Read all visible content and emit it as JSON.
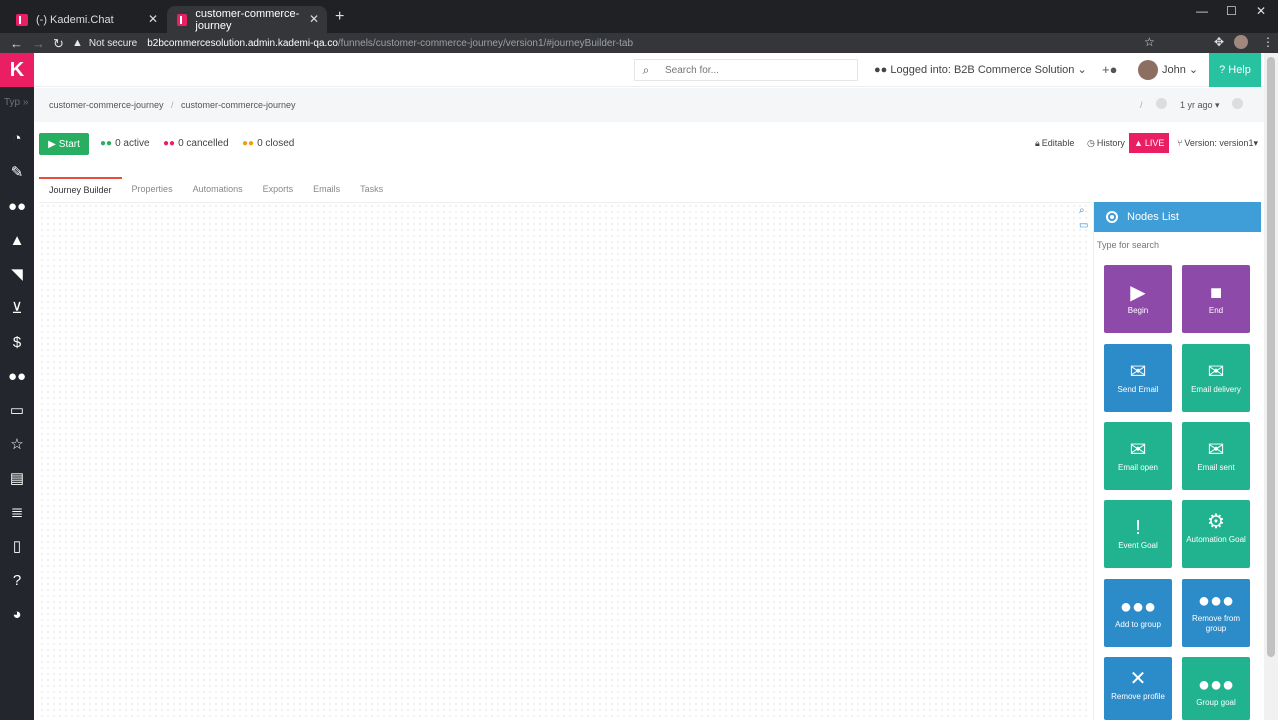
{
  "browser": {
    "tabs": [
      {
        "title": "(-) Kademi.Chat",
        "active": false
      },
      {
        "title": "customer-commerce-journey",
        "active": true
      }
    ],
    "security": "Not secure",
    "url_host": "b2bcommercesolution.admin.kademi-qa.co",
    "url_path": "/funnels/customer-commerce-journey/version1/#journeyBuilder-tab"
  },
  "sidebar": {
    "search": "Typ",
    "icons": [
      "dashboard-icon",
      "edit-icon",
      "users-icon",
      "graduation-icon",
      "rss-icon",
      "cart-icon",
      "dollar-icon",
      "group-icon",
      "monitor-icon",
      "star-icon",
      "id-card-icon",
      "database-icon",
      "file-icon",
      "question-icon",
      "pie-chart-icon"
    ]
  },
  "topbar": {
    "search_placeholder": "Search for...",
    "logged_into": "Logged into: B2B Commerce Solution",
    "user": "John",
    "help": "Help"
  },
  "breadcrumb": {
    "items": [
      "customer-commerce-journey",
      "customer-commerce-journey"
    ],
    "age": "1 yr ago"
  },
  "stats": {
    "start_label": "Start",
    "active": "0 active",
    "cancelled": "0 cancelled",
    "closed": "0 closed"
  },
  "actions": {
    "editable": "Editable",
    "history": "History",
    "live": "LIVE",
    "version": "Version: version1"
  },
  "tabs": [
    "Journey Builder",
    "Properties",
    "Automations",
    "Exports",
    "Emails",
    "Tasks"
  ],
  "nodes_list": {
    "title": "Nodes List",
    "search_placeholder": "Type for search",
    "nodes": [
      {
        "label": "Begin"
      },
      {
        "label": "End"
      },
      {
        "label": "Send Email"
      },
      {
        "label": "Email delivery"
      },
      {
        "label": "Email open"
      },
      {
        "label": "Email sent"
      },
      {
        "label": "Event Goal"
      },
      {
        "label": "Automation Goal"
      },
      {
        "label": "Add to group"
      },
      {
        "label": "Remove from group"
      },
      {
        "label": "Remove profile"
      },
      {
        "label": "Group goal"
      }
    ]
  },
  "colors": {
    "brand": "#e91e63",
    "accent": "#27c2a0",
    "start": "#27ae60",
    "node_purple": "#8e4aa9",
    "node_blue": "#2c8bc9",
    "node_teal": "#21b38f"
  }
}
